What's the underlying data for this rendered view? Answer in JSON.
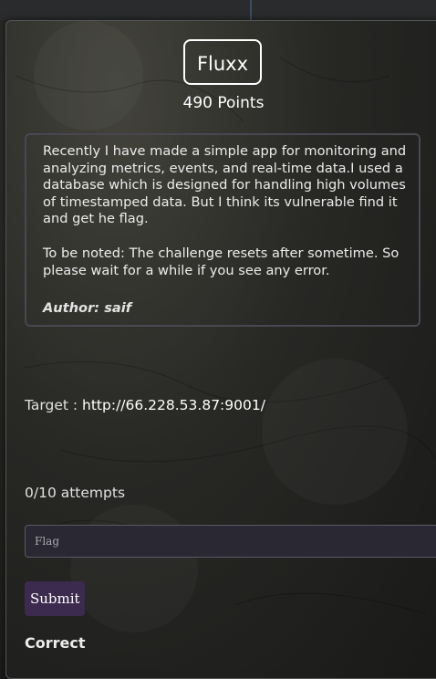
{
  "challenge": {
    "title": "Fluxx",
    "points": "490 Points",
    "description": {
      "paragraph1": "Recently I have made a simple app for monitoring and analyzing metrics, events, and real-time data.I used a database which is designed for handling high volumes of timestamped data. But I think its vulnerable find it and get he flag.",
      "paragraph2": "To be noted: The challenge resets after sometime. So please wait for a while if you see any error.",
      "author": "Author: saif"
    },
    "target": {
      "label": "Target : ",
      "url": "http://66.228.53.87:9001/"
    },
    "attempts": "0/10 attempts",
    "flag_input": {
      "placeholder": "Flag",
      "value": ""
    },
    "submit_label": "Submit",
    "result": "Correct"
  },
  "colors": {
    "submit_bg": "#3d2a4f",
    "input_bg": "#292833",
    "desc_border": "#4a4652"
  }
}
